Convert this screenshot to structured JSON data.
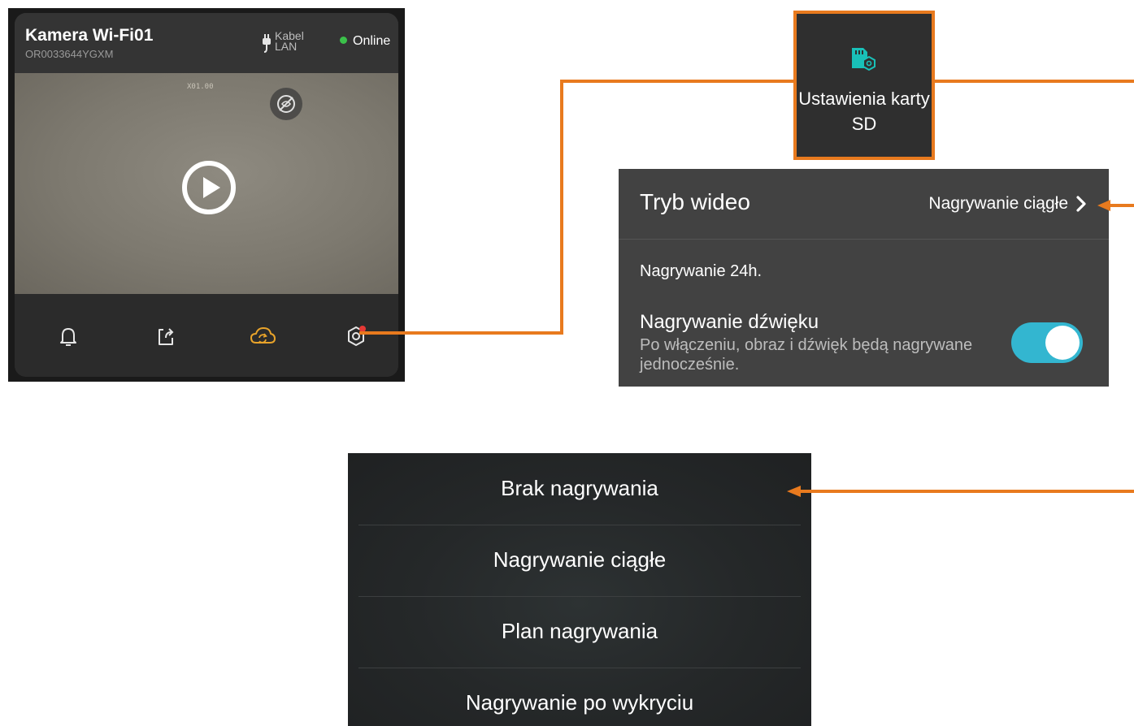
{
  "camera": {
    "name": "Kamera Wi-Fi01",
    "serial": "OR0033644YGXM",
    "connection_type": "Kabel LAN",
    "status": "Online",
    "overlay_timestamp": "X01.00",
    "toolbar_icons": [
      "bell-icon",
      "share-icon",
      "cloud-playback-icon",
      "settings-icon"
    ]
  },
  "sd_settings": {
    "label": "Ustawienia karty SD",
    "icon": "sd-card-settings-icon"
  },
  "video_mode": {
    "title": "Tryb wideo",
    "value": "Nagrywanie ciągłe",
    "description": "Nagrywanie 24h.",
    "audio_title": "Nagrywanie dźwięku",
    "audio_subtitle": "Po włączeniu, obraz i dźwięk będą nagrywane jednocześnie.",
    "audio_enabled": true
  },
  "options": [
    "Brak nagrywania",
    "Nagrywanie ciągłe",
    "Plan nagrywania",
    "Nagrywanie po wykryciu"
  ],
  "colors": {
    "accent_orange": "#e87a1e",
    "toggle_on": "#33b6d0",
    "online_dot": "#3bc14a",
    "cloud_icon": "#e8a32a",
    "notification_dot": "#e53935"
  }
}
